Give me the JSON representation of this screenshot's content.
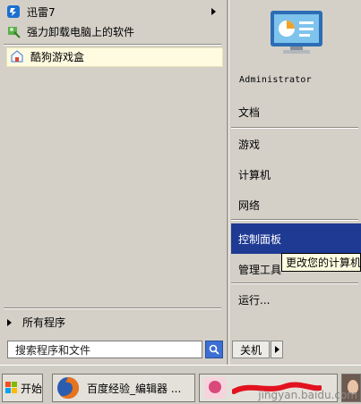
{
  "left_items": [
    {
      "label": "迅雷7"
    },
    {
      "label": "强力卸载电脑上的软件"
    },
    {
      "label": "酷狗游戏盒"
    }
  ],
  "all_programs": "所有程序",
  "search_placeholder": "搜索程序和文件",
  "power_label": "关机",
  "user_name": "Administrator",
  "right_items": [
    {
      "label": "文档"
    },
    {
      "label": "游戏"
    },
    {
      "label": "计算机"
    },
    {
      "label": "网络"
    },
    {
      "label": "控制面板"
    },
    {
      "label": "管理工具"
    },
    {
      "label": "运行..."
    }
  ],
  "tooltip": "更改您的计算机",
  "taskbar": {
    "start_label": "开始",
    "task1_label": "百度经验_编辑器 ...",
    "watermark": "jingyan.baidu.com"
  },
  "colors": {
    "highlight": "#1f3a93",
    "pinned_highlight": "#fffbe0",
    "tooltip_bg": "#ffffe1"
  }
}
